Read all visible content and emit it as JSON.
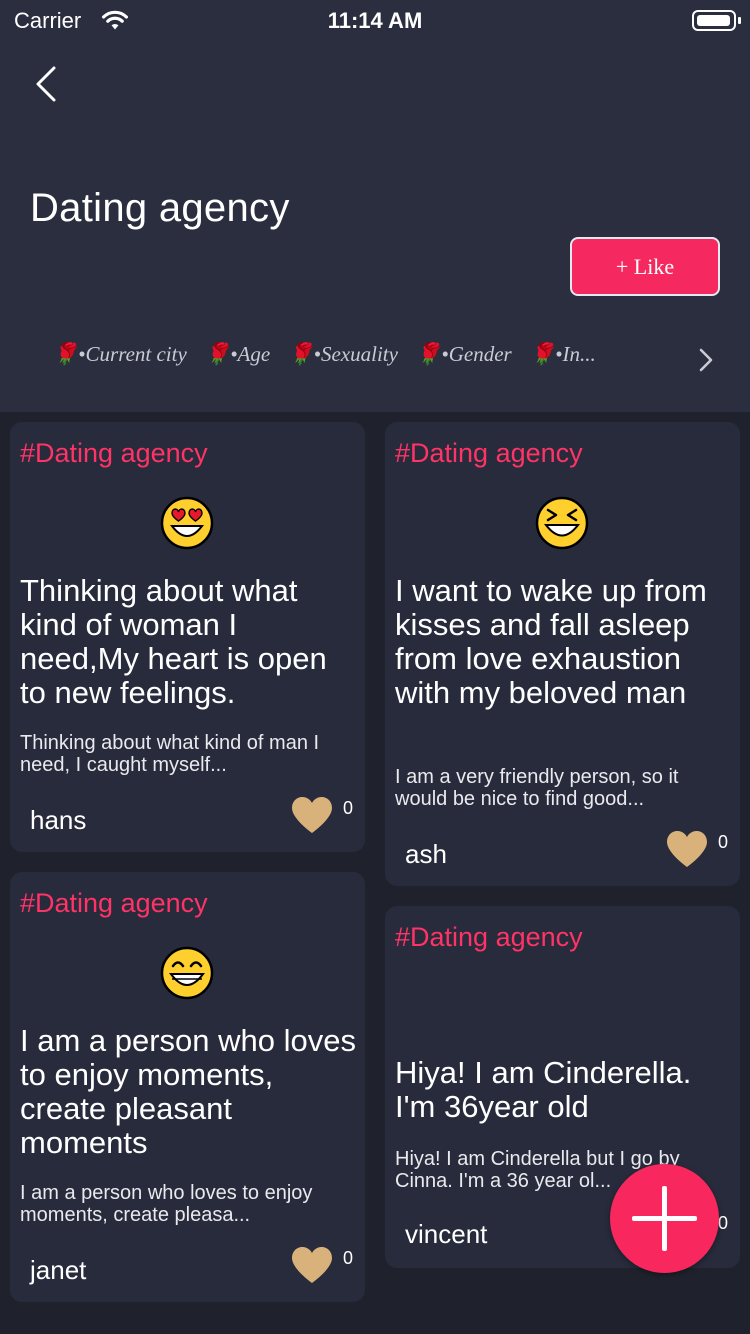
{
  "status_bar": {
    "carrier": "Carrier",
    "time": "11:14 AM"
  },
  "header": {
    "title": "Dating agency",
    "like_button": "+ Like",
    "tags": [
      "•Current city",
      "•Age",
      "•Sexuality",
      "•Gender",
      "•In..."
    ]
  },
  "cards": [
    {
      "tag": "#Dating agency",
      "emoji": "heart-eyes-emoji",
      "title": "Thinking about what kind of woman I need,My heart is open to new feelings.",
      "snippet": "Thinking about what kind of man I need, I caught myself...",
      "user": "hans",
      "likes": "0"
    },
    {
      "tag": "#Dating agency",
      "emoji": "laughing-emoji",
      "title": "I want to wake up from kisses and fall asleep from love exhaustion with my beloved man",
      "snippet": "I am a very friendly person, so it would be nice to find good...",
      "user": "ash",
      "likes": "0"
    },
    {
      "tag": "#Dating agency",
      "emoji": "grinning-emoji",
      "title": "I am a person who loves to enjoy moments, create pleasant moments",
      "snippet": "I am a person who loves to enjoy moments, create pleasa...",
      "user": "janet",
      "likes": "0"
    },
    {
      "tag": "#Dating agency",
      "emoji": "",
      "title": "Hiya! I am Cinderella. I'm 36year old",
      "snippet": "Hiya! I am Cinderella but I go by Cinna. I'm a 36 year ol...",
      "user": "vincent",
      "likes": "0"
    }
  ],
  "colors": {
    "accent": "#f5295f",
    "header_bg": "#2a2e3f",
    "card_bg": "#272b3b",
    "heart": "#d8b27a"
  },
  "icons": [
    "chevron-left-icon",
    "wifi-icon",
    "battery-icon",
    "rose-icon",
    "chevron-right-icon",
    "heart-icon",
    "plus-icon"
  ]
}
